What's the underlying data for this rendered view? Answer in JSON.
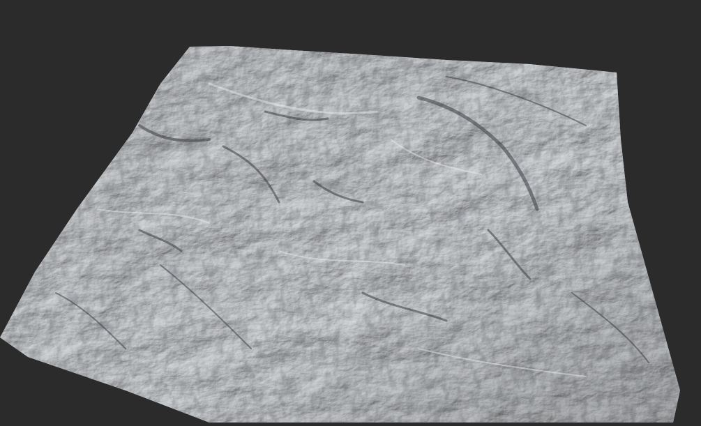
{
  "viewport": {
    "background_color": "#2b2b2b"
  },
  "terrain": {
    "description_icon": "terrain-heightmap-render",
    "surface_color_light": "#c9ccd0",
    "surface_color_mid": "#a9adb3",
    "surface_color_dark": "#5d6168",
    "ridge_color": "#3a3d42"
  }
}
